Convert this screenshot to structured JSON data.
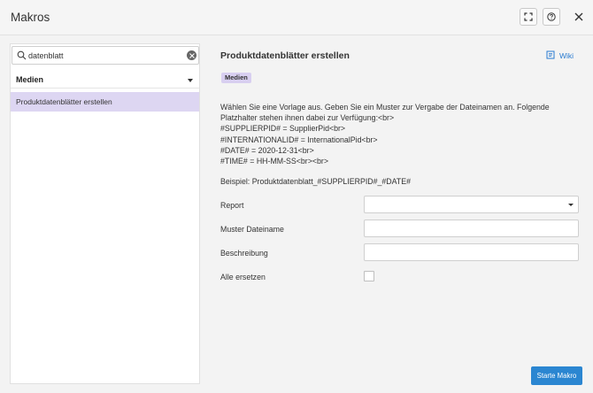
{
  "dialog": {
    "title": "Makros"
  },
  "search": {
    "value": "datenblatt",
    "placeholder": ""
  },
  "sidebar": {
    "group_label": "Medien",
    "items": [
      {
        "label": "Produktdatenblätter erstellen",
        "selected": true
      }
    ]
  },
  "detail": {
    "title": "Produktdatenblätter erstellen",
    "wiki_label": "Wiki",
    "badge": "Medien",
    "description_lines": [
      "Wählen Sie eine Vorlage aus. Geben Sie ein Muster zur Vergabe der Dateinamen an. Folgende Platzhalter stehen ihnen dabei zur Verfügung:<br>",
      "#SUPPLIERPID# = SupplierPid<br>",
      "#INTERNATIONALID# = InternationalPid<br>",
      "#DATE# = 2020-12-31<br>",
      "#TIME# = HH-MM-SS<br><br>"
    ],
    "example": "Beispiel: Produktdatenblatt_#SUPPLIERPID#_#DATE#",
    "fields": {
      "report_label": "Report",
      "report_value": "",
      "filename_label": "Muster Dateiname",
      "filename_value": "",
      "description_label": "Beschreibung",
      "description_value": "",
      "replace_all_label": "Alle ersetzen",
      "replace_all_checked": false
    },
    "start_button": "Starte Makro"
  },
  "colors": {
    "accent": "#2b86d1",
    "selection": "#ddd6f2",
    "badge": "#d8cff0",
    "link": "#2a7bd0"
  },
  "icons": {
    "fullscreen": "fullscreen-icon",
    "help": "help-icon",
    "close": "close-icon",
    "search": "search-icon",
    "clear": "clear-icon",
    "wiki": "book-icon"
  }
}
